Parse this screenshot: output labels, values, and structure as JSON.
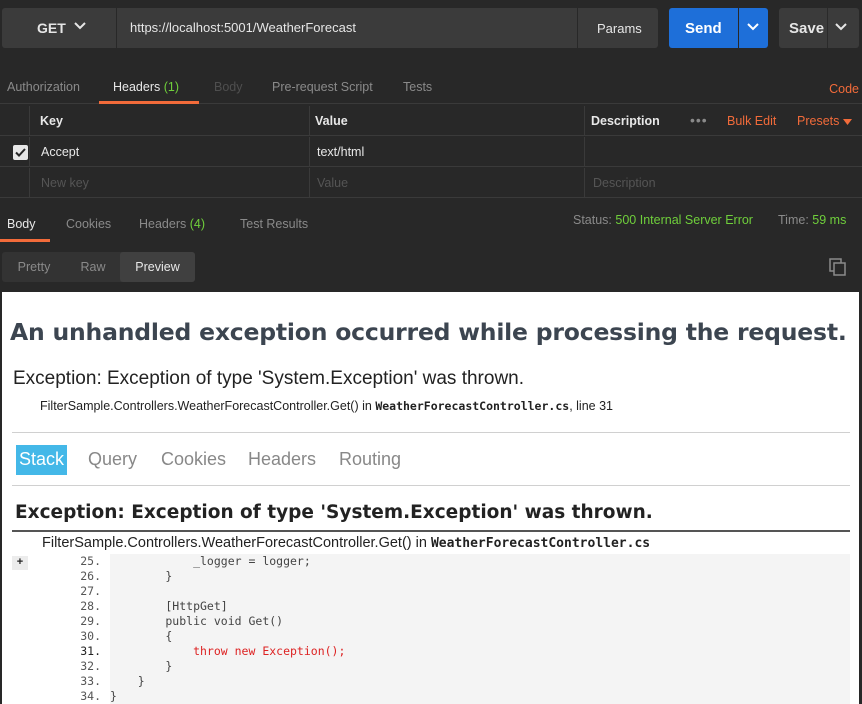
{
  "request": {
    "method": "GET",
    "url": "https://localhost:5001/WeatherForecast",
    "params_label": "Params",
    "send_label": "Send",
    "save_label": "Save"
  },
  "request_tabs": {
    "authorization": "Authorization",
    "headers": "Headers",
    "headers_count": "(1)",
    "body": "Body",
    "pre_request": "Pre-request Script",
    "tests": "Tests",
    "code": "Code"
  },
  "headers_table": {
    "col_key": "Key",
    "col_value": "Value",
    "col_description": "Description",
    "dots": "•••",
    "bulk_edit": "Bulk Edit",
    "presets": "Presets",
    "rows": [
      {
        "key": "Accept",
        "value": "text/html",
        "checked": true
      }
    ],
    "placeholder_key": "New key",
    "placeholder_value": "Value",
    "placeholder_description": "Description"
  },
  "response_tabs": {
    "body": "Body",
    "cookies": "Cookies",
    "headers": "Headers",
    "headers_count": "(4)",
    "test_results": "Test Results",
    "status_label": "Status:",
    "status_value": "500 Internal Server Error",
    "time_label": "Time:",
    "time_value": "59 ms"
  },
  "view_modes": {
    "pretty": "Pretty",
    "raw": "Raw",
    "preview": "Preview"
  },
  "preview": {
    "title": "An unhandled exception occurred while processing the request.",
    "exception": "Exception: Exception of type 'System.Exception' was thrown.",
    "location_method": "FilterSample.Controllers.WeatherForecastController.Get() in ",
    "location_file": "WeatherForecastController.cs",
    "location_line": ", line 31",
    "tabs": [
      "Stack",
      "Query",
      "Cookies",
      "Headers",
      "Routing"
    ],
    "stack_exception": "Exception: Exception of type 'System.Exception' was thrown.",
    "stack_method": "FilterSample.Controllers.WeatherForecastController.Get() in ",
    "stack_file": "WeatherForecastController.cs",
    "expand": "+",
    "code_lines": [
      {
        "num": "25.",
        "code": "            _logger = logger;"
      },
      {
        "num": "26.",
        "code": "        }"
      },
      {
        "num": "27.",
        "code": ""
      },
      {
        "num": "28.",
        "code": "        [HttpGet]"
      },
      {
        "num": "29.",
        "code": "        public void Get()"
      },
      {
        "num": "30.",
        "code": "        {"
      },
      {
        "num": "31.",
        "code": "            throw new Exception();"
      },
      {
        "num": "32.",
        "code": "        }"
      },
      {
        "num": "33.",
        "code": "    }"
      },
      {
        "num": "34.",
        "code": "}"
      }
    ]
  }
}
